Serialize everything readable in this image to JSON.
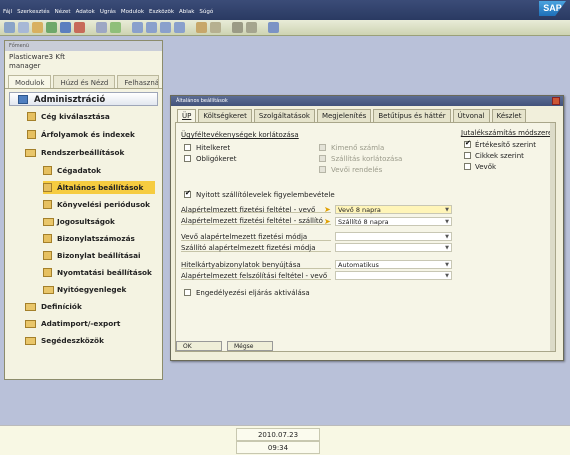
{
  "menubar": {
    "items": [
      "Fájl",
      "Szerkesztés",
      "Nézet",
      "Adatok",
      "Ugrás",
      "Modulok",
      "Eszközök",
      "Ablak",
      "Súgó"
    ],
    "logo": "SAP"
  },
  "main_menu": {
    "title": "Főmenü",
    "company": "Plasticware3 Kft",
    "user": "manager",
    "tabs": [
      "Modulok",
      "Húzd és Nézd",
      "Felhasznál"
    ],
    "header": "Adminisztráció",
    "items": [
      "Cég kiválasztása",
      "Árfolyamok és indexek",
      "Rendszerbeállítások",
      "Cégadatok",
      "Általános beállítások",
      "Könyvelési periódusok",
      "Jogosultságok",
      "Bizonylatszámozás",
      "Bizonylat beállításai",
      "Nyomtatási beállítások",
      "Nyitóegyenlegek",
      "Definíciók",
      "Adatimport/-export",
      "Segédeszközök"
    ],
    "selected_item": "Általános beállítások"
  },
  "dialog": {
    "title": "Általános beállítások",
    "tabs": [
      "ÜP",
      "Költségkeret",
      "Szolgáltatások",
      "Megjelenítés",
      "Betűtípus és háttér",
      "Útvonal",
      "Készlet"
    ],
    "active_tab": "ÜP",
    "section_left": "Ügyféltevékenységek korlátozása",
    "chk_hitelkeret": "Hitelkeret",
    "chk_obligokeret": "Obligókeret",
    "chk_kimeno": "Kimenő számla",
    "chk_szallitas": "Szállítás korlátozása",
    "chk_vevoi": "Vevői rendelés",
    "section_right": "Jutalékszámítás módszere",
    "chk_ertekesito": "Értékesítő szerint",
    "chk_cikkek": "Cikkek szerint",
    "chk_vevok": "Vevők",
    "chk_nyitott": "Nyitott szállítólevelek figyelembevétele",
    "lbl_fiz_vevo": "Alapértelmezett fizetési feltétel - vevő",
    "val_fiz_vevo": "Vevő 8 napra",
    "lbl_fiz_szall": "Alapértelmezett fizetési feltétel - szállító",
    "val_fiz_szall": "Szállító 8 napra",
    "lbl_vevo_modja": "Vevő alapértelmezett fizetési módja",
    "lbl_szall_modja": "Szállító alapértelmezett fizetési módja",
    "lbl_hitelkartya": "Hitelkártyabizonylatok benyújtása",
    "val_hitelkartya": "Automatikus",
    "lbl_felszolitas": "Alapértelmezett felszólítási feltétel - vevő",
    "chk_engedelyezesi": "Engedélyezési eljárás aktiválása",
    "btn_ok": "OK",
    "btn_megse": "Mégse"
  },
  "statusbar": {
    "date": "2010.07.23",
    "time": "09:34"
  }
}
